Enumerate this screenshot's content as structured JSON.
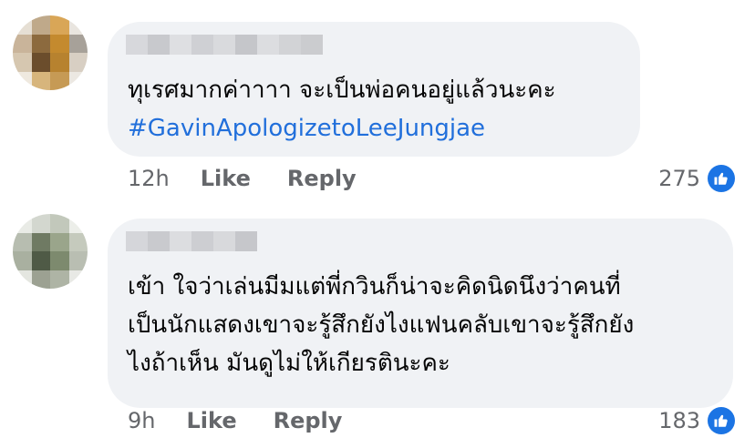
{
  "comments": [
    {
      "text_line1": "ทุเรศมากค่าาาา จะเป็นพ่อคนอยู่แล้วนะคะ",
      "hashtag": "#GavinApologizetoLeeJungjae",
      "time": "12h",
      "like_label": "Like",
      "reply_label": "Reply",
      "reaction_count": "275",
      "reaction_icon": "thumbs-up-icon"
    },
    {
      "text_line1": "เข้า ใจว่าเล่นมีมแต่พี่กวินก็น่าจะคิดนิดนึงว่าคนที่",
      "text_line2": "เป็นนักแสดงเขาจะรู้สึกยังไงแฟนคลับเขาจะรู้สึกยัง",
      "text_line3": "ไงถ้าเห็น มันดูไม่ให้เกียรตินะคะ",
      "time": "9h",
      "like_label": "Like",
      "reply_label": "Reply",
      "reaction_count": "183",
      "reaction_icon": "thumbs-up-icon"
    }
  ],
  "colors": {
    "bubble": "#f0f2f5",
    "hashtag": "#216fdb",
    "meta": "#65676b",
    "like_badge": "#1b74e4"
  }
}
